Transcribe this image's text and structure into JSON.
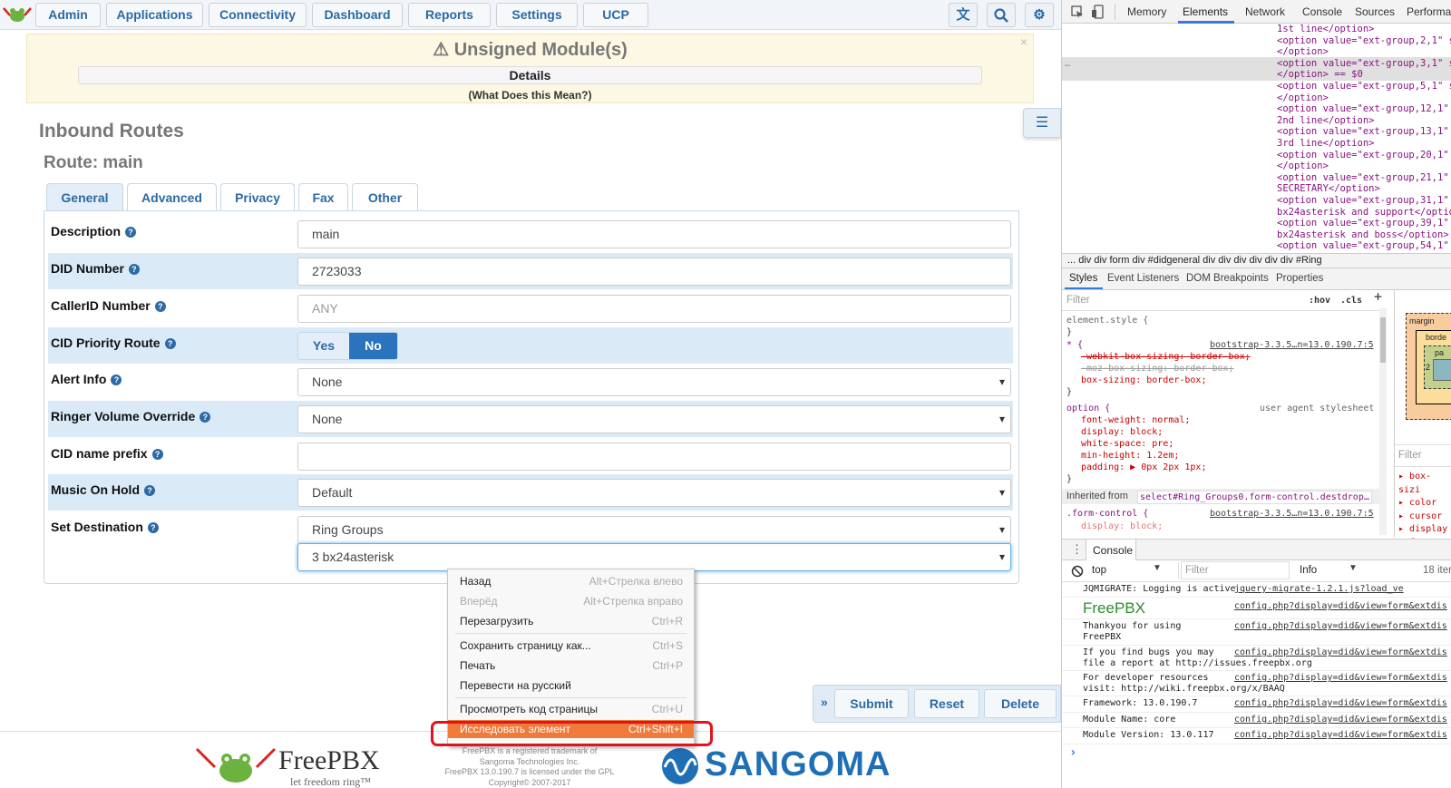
{
  "nav": {
    "items": [
      "Admin",
      "Applications",
      "Connectivity",
      "Dashboard",
      "Reports",
      "Settings",
      "UCP"
    ]
  },
  "banner": {
    "title": "Unsigned Module(s)",
    "details": "Details",
    "what": "(What Does this Mean?)",
    "close": "×"
  },
  "page": {
    "title": "Inbound Routes",
    "route": "Route: main"
  },
  "tabs": [
    "General",
    "Advanced",
    "Privacy",
    "Fax",
    "Other"
  ],
  "form": {
    "description": {
      "label": "Description",
      "value": "main"
    },
    "did": {
      "label": "DID Number",
      "value": "2723033"
    },
    "callerid": {
      "label": "CallerID Number",
      "placeholder": "ANY"
    },
    "priority": {
      "label": "CID Priority Route",
      "yes": "Yes",
      "no": "No",
      "selected": "No"
    },
    "alert": {
      "label": "Alert Info",
      "value": "None"
    },
    "ringer": {
      "label": "Ringer Volume Override",
      "value": "None"
    },
    "prefix": {
      "label": "CID name prefix",
      "value": ""
    },
    "moh": {
      "label": "Music On Hold",
      "value": "Default"
    },
    "destination": {
      "label": "Set Destination",
      "type": "Ring Groups",
      "target": "3 bx24asterisk"
    }
  },
  "actions": {
    "expand": "»",
    "submit": "Submit",
    "reset": "Reset",
    "delete": "Delete"
  },
  "footer": {
    "freepbx": "FreePBX",
    "tagline": "let freedom ring™",
    "lines": [
      "FreePBX is a registered trademark of",
      "Sangoma Technologies Inc.",
      "FreePBX 13.0.190.7 is licensed under the GPL",
      "Copyright© 2007-2017"
    ],
    "sangoma": "SANGOMA"
  },
  "context_menu": [
    {
      "label": "Назад",
      "shortcut": "Alt+Стрелка влево",
      "disabled": false
    },
    {
      "label": "Вперёд",
      "shortcut": "Alt+Стрелка вправо",
      "disabled": true
    },
    {
      "label": "Перезагрузить",
      "shortcut": "Ctrl+R",
      "disabled": false
    },
    {
      "label": "Сохранить страницу как...",
      "shortcut": "Ctrl+S",
      "disabled": false
    },
    {
      "label": "Печать",
      "shortcut": "Ctrl+P",
      "disabled": false
    },
    {
      "label": "Перевести на русский",
      "shortcut": "",
      "disabled": false
    },
    {
      "label": "Просмотреть код страницы",
      "shortcut": "Ctrl+U",
      "disabled": false
    },
    {
      "label": "Исследовать элемент",
      "shortcut": "Ctrl+Shift+I",
      "disabled": false
    }
  ],
  "devtools": {
    "tabs": [
      "Memory",
      "Elements",
      "Network",
      "Console",
      "Sources",
      "Performa"
    ],
    "active_tab": "Elements",
    "code_lines": [
      "1st line</option>",
      "<option value=\"ext-group,2,1\" s",
      "</option>",
      "<option value=\"ext-group,3,1\" s",
      "</option> == $0",
      "<option value=\"ext-group,5,1\" s",
      "</option>",
      "<option value=\"ext-group,12,1\"",
      "2nd line</option>",
      "<option value=\"ext-group,13,1\"",
      "3rd line</option>",
      "<option value=\"ext-group,20,1\"",
      "</option>",
      "<option value=\"ext-group,21,1\"",
      "SECRETARY</option>",
      "<option value=\"ext-group,31,1\"",
      "bx24asterisk and support</optio",
      "<option value=\"ext-group,39,1\"",
      "bx24asterisk and boss</option>",
      "<option value=\"ext-group,54,1\""
    ],
    "breadcrumbs": "...  div  div  form  div  #didgeneral  div  div  div  div  div  div  #Ring",
    "subtabs": [
      "Styles",
      "Event Listeners",
      "DOM Breakpoints",
      "Properties"
    ],
    "filter": "Filter",
    "hov": ":hov",
    "cls": ".cls",
    "styles": {
      "element_style": "element.style {",
      "close": "}",
      "star_rule": "* {",
      "bootstrap_link": "bootstrap-3.3.5…n=13.0.190.7:5",
      "star_props": [
        "-webkit-box-sizing: border-box;",
        "-moz-box-sizing: border-box;",
        "box-sizing: border-box;"
      ],
      "option_rule": "option {",
      "ua": "user agent stylesheet",
      "option_props": [
        "font-weight: normal;",
        "display: block;",
        "white-space: pre;",
        "min-height: 1.2em;",
        "padding: ▶ 0px 2px 1px;"
      ],
      "inherited_label": "Inherited from",
      "inherited_sel": "select#Ring_Groups0.form-control.destdrop…",
      "form_control": ".form-control {",
      "form_display": "display: block;"
    },
    "box": {
      "margin": "margin",
      "border": "borde",
      "padding": "pa",
      "num": "2"
    },
    "computed_filter": "Filter",
    "computed": [
      "box-sizi",
      "color",
      "cursor",
      "display",
      "font-fam"
    ],
    "console": {
      "title": "Console",
      "context": "top",
      "filter": "Filter",
      "level": "Info",
      "count": "18 iter",
      "messages": [
        {
          "text": "JQMIGRATE: Logging is active",
          "link": "jquery-migrate-1.2.1.js?load_ve"
        },
        {
          "text": "FreePBX",
          "link": "config.php?display=did&view=form&extdis"
        },
        {
          "text": "Thankyou for using\nFreePBX",
          "link": "config.php?display=did&view=form&extdis"
        },
        {
          "text": "If you find bugs you may\nfile a report at http://issues.freepbx.org",
          "link": "config.php?display=did&view=form&extdis"
        },
        {
          "text": "For developer resources\nvisit: http://wiki.freepbx.org/x/BAAQ",
          "link": "config.php?display=did&view=form&extdis"
        },
        {
          "text": "Framework: 13.0.190.7",
          "link": "config.php?display=did&view=form&extdis"
        },
        {
          "text": "Module Name: core",
          "link": "config.php?display=did&view=form&extdis"
        },
        {
          "text": "Module Version: 13.0.117",
          "link": "config.php?display=did&view=form&extdis"
        }
      ],
      "prompt": "›"
    }
  }
}
